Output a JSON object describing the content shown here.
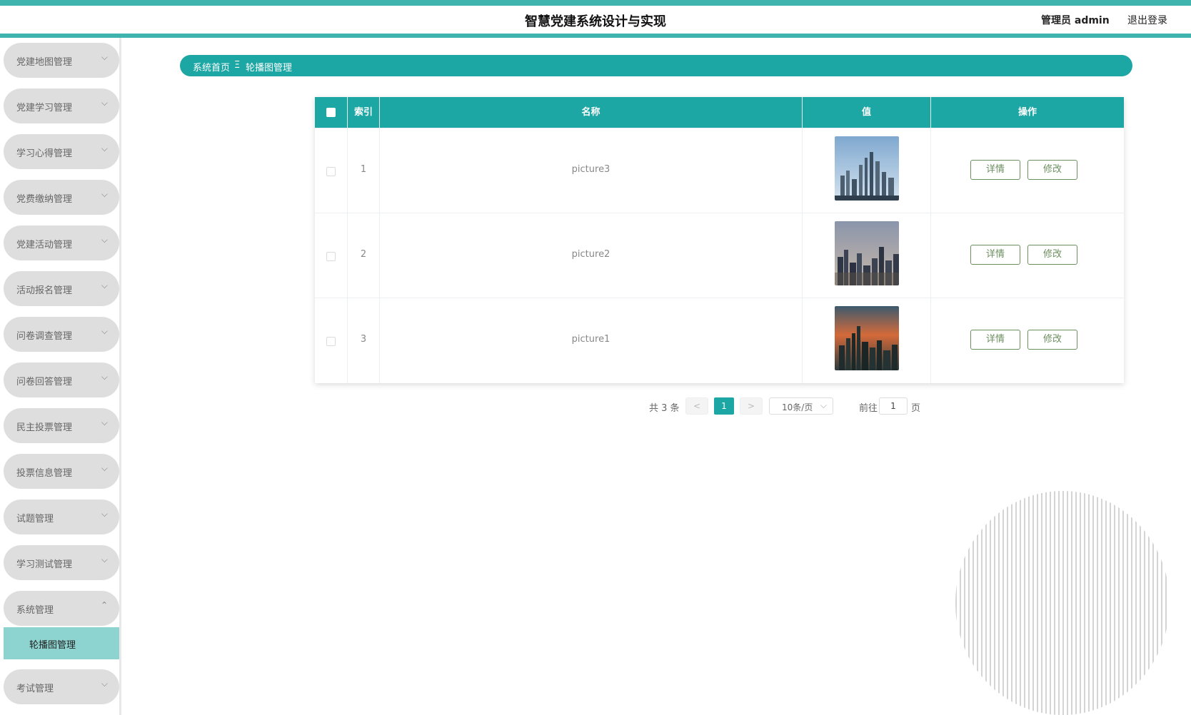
{
  "header": {
    "title": "智慧党建系统设计与实现",
    "user": "管理员 admin",
    "logout": "退出登录"
  },
  "sidebar": {
    "items": [
      {
        "label": "党建地图管理"
      },
      {
        "label": "党建学习管理"
      },
      {
        "label": "学习心得管理"
      },
      {
        "label": "党费缴纳管理"
      },
      {
        "label": "党建活动管理"
      },
      {
        "label": "活动报名管理"
      },
      {
        "label": "问卷调查管理"
      },
      {
        "label": "问卷回答管理"
      },
      {
        "label": "民主投票管理"
      },
      {
        "label": "投票信息管理"
      },
      {
        "label": "试题管理"
      },
      {
        "label": "学习测试管理"
      },
      {
        "label": "系统管理"
      },
      {
        "label": "考试管理"
      }
    ],
    "submenu": {
      "label": "轮播图管理"
    }
  },
  "breadcrumb": {
    "home": "系统首页",
    "separator": "Ξ",
    "current": "轮播图管理"
  },
  "table": {
    "headers": {
      "index": "索引",
      "name": "名称",
      "value": "值",
      "action": "操作"
    },
    "rows": [
      {
        "index": "1",
        "name": "picture3"
      },
      {
        "index": "2",
        "name": "picture2"
      },
      {
        "index": "3",
        "name": "picture1"
      }
    ],
    "detail_label": "详情",
    "edit_label": "修改"
  },
  "pagination": {
    "total": "共 3 条",
    "prev": "<",
    "current": "1",
    "next": ">",
    "page_size": "10条/页",
    "goto_label": "前往",
    "goto_value": "1",
    "page_suffix": "页"
  },
  "colors": {
    "accent": "#1ca6a4",
    "header_stripe": "#3fb3ad",
    "submenu_active": "#8dd3cf",
    "button_text": "#6b8f5f"
  }
}
